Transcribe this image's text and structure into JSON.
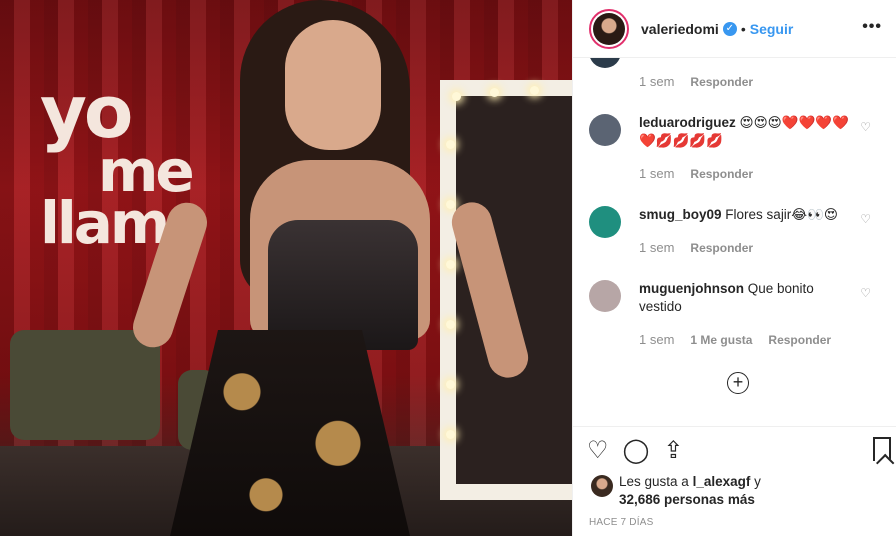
{
  "post": {
    "username": "valeriedomi",
    "verified_symbol": "✓",
    "separator": "•",
    "follow_label": "Seguir",
    "more_icon": "•••"
  },
  "comments": [
    {
      "time": "1 sem",
      "reply_label": "Responder"
    },
    {
      "username": "leduarodriguez",
      "text": "😍😍😍❤️❤️❤️❤️❤️💋💋💋💋",
      "time": "1 sem",
      "reply_label": "Responder",
      "avatar_color": "#5b6473"
    },
    {
      "username": "smug_boy09",
      "text": "Flores sajir😂👀😍",
      "time": "1 sem",
      "reply_label": "Responder",
      "avatar_color": "#1f8f7f"
    },
    {
      "username": "muguenjohnson",
      "text": "Que bonito vestido",
      "time": "1 sem",
      "likes_label": "1 Me gusta",
      "reply_label": "Responder",
      "avatar_color": "#b7a6a6"
    }
  ],
  "likes": {
    "prefix": "Les gusta a",
    "user": "l_alexagf",
    "conj": "y",
    "count_text": "32,686 personas más"
  },
  "timestamp": "HACE 7 DÍAS",
  "photo": {
    "sign_line1": "yo",
    "sign_line2": "me",
    "sign_line3": "llam"
  }
}
